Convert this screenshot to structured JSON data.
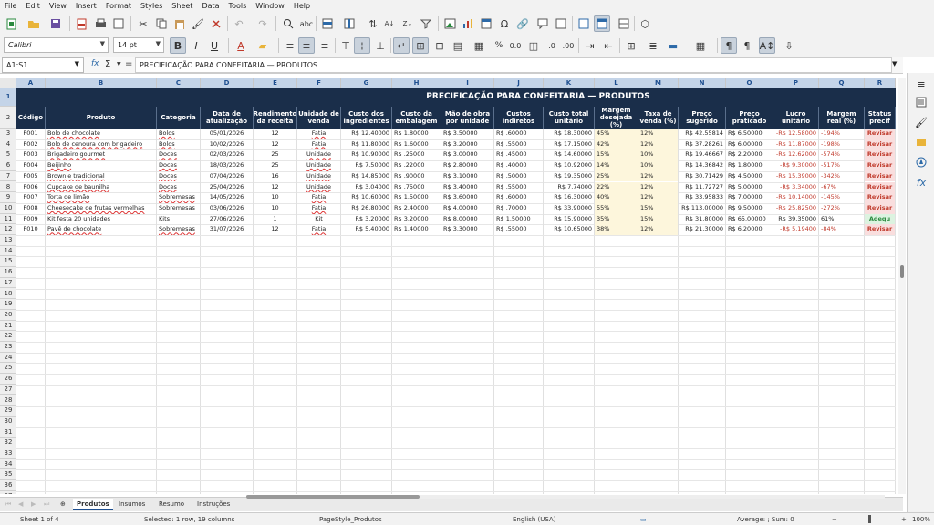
{
  "menu": [
    "File",
    "Edit",
    "View",
    "Insert",
    "Format",
    "Styles",
    "Sheet",
    "Data",
    "Tools",
    "Window",
    "Help"
  ],
  "toolbar": {
    "font_name": "Calibri",
    "font_size": "14 pt"
  },
  "formula_bar": {
    "name_box": "A1:S1",
    "fx": "fx",
    "sigma": "Σ",
    "equals": "=",
    "content": "PRECIFICAÇÃO PARA CONFEITARIA — PRODUTOS"
  },
  "columns": [
    "A",
    "B",
    "C",
    "D",
    "E",
    "F",
    "G",
    "H",
    "I",
    "J",
    "K",
    "L",
    "M",
    "N",
    "O",
    "P",
    "Q",
    "R"
  ],
  "rows": [
    "1",
    "2",
    "3",
    "4",
    "5",
    "6",
    "7",
    "8",
    "9",
    "10",
    "11",
    "12",
    "13",
    "14",
    "15",
    "16",
    "17",
    "18",
    "19",
    "20",
    "21",
    "22",
    "23",
    "24",
    "25",
    "26",
    "27",
    "28",
    "29",
    "30",
    "31",
    "32",
    "33",
    "34",
    "35",
    "36",
    "37"
  ],
  "sheet": {
    "title": "PRECIFICAÇÃO PARA CONFEITARIA — PRODUTOS",
    "headers": [
      "Código",
      "Produto",
      "Categoria",
      "Data de atualização",
      "Rendimento da receita",
      "Unidade de venda",
      "Custo dos ingredientes",
      "Custo da embalagem",
      "Mão de obra por unidade",
      "Custos indiretos",
      "Custo total unitário",
      "Margem desejada (%)",
      "Taxa de venda (%)",
      "Preço sugerido",
      "Preço praticado",
      "Lucro unitário",
      "Margem real (%)",
      "Status precif"
    ],
    "data": [
      [
        "P001",
        "Bolo de chocolate",
        "Bolos",
        "05/01/2026",
        "12",
        "Fatia",
        "R$ 12.40000",
        "R$ 1.80000",
        "R$ 3.50000",
        "R$ .60000",
        "R$ 18.30000",
        "45%",
        "12%",
        "R$ 42.55814",
        "R$ 6.50000",
        "-R$ 12.58000",
        "-194%",
        "Revisar"
      ],
      [
        "P002",
        "Bolo de cenoura com brigadeiro",
        "Bolos",
        "10/02/2026",
        "12",
        "Fatia",
        "R$ 11.80000",
        "R$ 1.60000",
        "R$ 3.20000",
        "R$ .55000",
        "R$ 17.15000",
        "42%",
        "12%",
        "R$ 37.28261",
        "R$ 6.00000",
        "-R$ 11.87000",
        "-198%",
        "Revisar"
      ],
      [
        "P003",
        "Brigadeiro gourmet",
        "Doces",
        "02/03/2026",
        "25",
        "Unidade",
        "R$ 10.90000",
        "R$ .25000",
        "R$ 3.00000",
        "R$ .45000",
        "R$ 14.60000",
        "15%",
        "10%",
        "R$ 19.46667",
        "R$ 2.20000",
        "-R$ 12.62000",
        "-574%",
        "Revisar"
      ],
      [
        "P004",
        "Beijinho",
        "Doces",
        "18/03/2026",
        "25",
        "Unidade",
        "R$ 7.50000",
        "R$ .22000",
        "R$ 2.80000",
        "R$ .40000",
        "R$ 10.92000",
        "14%",
        "10%",
        "R$ 14.36842",
        "R$ 1.80000",
        "-R$ 9.30000",
        "-517%",
        "Revisar"
      ],
      [
        "P005",
        "Brownie tradicional",
        "Doces",
        "07/04/2026",
        "16",
        "Unidade",
        "R$ 14.85000",
        "R$ .90000",
        "R$ 3.10000",
        "R$ .50000",
        "R$ 19.35000",
        "25%",
        "12%",
        "R$ 30.71429",
        "R$ 4.50000",
        "-R$ 15.39000",
        "-342%",
        "Revisar"
      ],
      [
        "P006",
        "Cupcake de baunilha",
        "Doces",
        "25/04/2026",
        "12",
        "Unidade",
        "R$ 3.04000",
        "R$ .75000",
        "R$ 3.40000",
        "R$ .55000",
        "R$ 7.74000",
        "22%",
        "12%",
        "R$ 11.72727",
        "R$ 5.00000",
        "-R$ 3.34000",
        "-67%",
        "Revisar"
      ],
      [
        "P007",
        "Torta de limão",
        "Sobremesas",
        "14/05/2026",
        "10",
        "Fatia",
        "R$ 10.60000",
        "R$ 1.50000",
        "R$ 3.60000",
        "R$ .60000",
        "R$ 16.30000",
        "40%",
        "12%",
        "R$ 33.95833",
        "R$ 7.00000",
        "-R$ 10.14000",
        "-145%",
        "Revisar"
      ],
      [
        "P008",
        "Cheesecake de frutas vermelhas",
        "Sobremesas",
        "03/06/2026",
        "10",
        "Fatia",
        "R$ 26.80000",
        "R$ 2.40000",
        "R$ 4.00000",
        "R$ .70000",
        "R$ 33.90000",
        "55%",
        "15%",
        "R$ 113.00000",
        "R$ 9.50000",
        "-R$ 25.82500",
        "-272%",
        "Revisar"
      ],
      [
        "P009",
        "Kit festa 20 unidades",
        "Kits",
        "27/06/2026",
        "1",
        "Kit",
        "R$ 3.20000",
        "R$ 3.20000",
        "R$ 8.00000",
        "R$ 1.50000",
        "R$ 15.90000",
        "35%",
        "15%",
        "R$ 31.80000",
        "R$ 65.00000",
        "R$ 39.35000",
        "61%",
        "Adequ"
      ],
      [
        "P010",
        "Pavê de chocolate",
        "Sobremesas",
        "31/07/2026",
        "12",
        "Fatia",
        "R$ 5.40000",
        "R$ 1.40000",
        "R$ 3.30000",
        "R$ .55000",
        "R$ 10.65000",
        "38%",
        "12%",
        "R$ 21.30000",
        "R$ 6.20000",
        "-R$ 5.19400",
        "-84%",
        "Revisar"
      ]
    ]
  },
  "tabs": [
    "Produtos",
    "Insumos",
    "Resumo",
    "Instruções"
  ],
  "status": {
    "sheet": "Sheet 1 of 4",
    "selection": "Selected: 1 row, 19 columns",
    "page_style": "PageStyle_Produtos",
    "language": "English (USA)",
    "summary": "Average: ; Sum: 0",
    "zoom": "100%"
  },
  "colors": {
    "header_bg": "#1a2e4a",
    "input_bg": "#fdf6dc",
    "negative": "#c0392b",
    "ok": "#2a8a3e"
  }
}
